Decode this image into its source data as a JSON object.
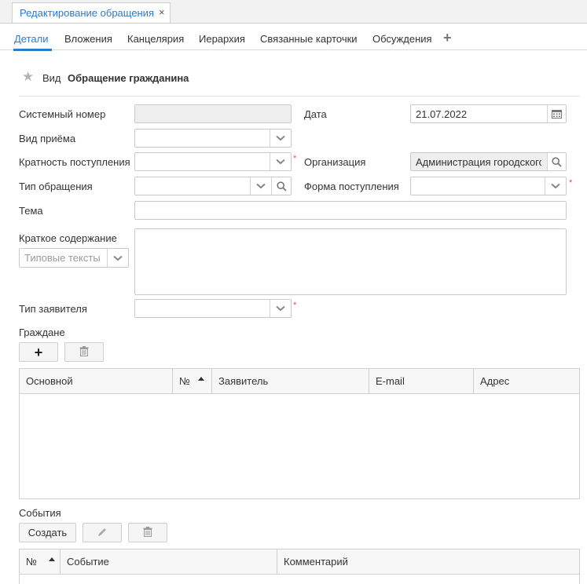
{
  "doc_tab": {
    "label": "Редактирование обращения",
    "close": "×"
  },
  "tabs": [
    {
      "label": "Детали"
    },
    {
      "label": "Вложения"
    },
    {
      "label": "Канцелярия"
    },
    {
      "label": "Иерархия"
    },
    {
      "label": "Связанные карточки"
    },
    {
      "label": "Обсуждения"
    }
  ],
  "kind": {
    "label": "Вид",
    "value": "Обращение гражданина"
  },
  "form": {
    "system_number_label": "Системный номер",
    "date_label": "Дата",
    "date_value": "21.07.2022",
    "reception_type_label": "Вид приёма",
    "frequency_label": "Кратность поступления",
    "organization_label": "Организация",
    "organization_value": "Администрация городского",
    "appeal_type_label": "Тип обращения",
    "receipt_form_label": "Форма поступления",
    "subject_label": "Тема",
    "summary_label": "Краткое содержание",
    "template_texts_placeholder": "Типовые тексты",
    "applicant_type_label": "Тип заявителя",
    "required_mark": "*"
  },
  "citizens": {
    "title": "Граждане",
    "columns": [
      "Основной",
      "№",
      "Заявитель",
      "E-mail",
      "Адрес"
    ]
  },
  "events": {
    "title": "События",
    "create_label": "Создать",
    "columns": [
      "№",
      "Событие",
      "Комментарий"
    ]
  }
}
